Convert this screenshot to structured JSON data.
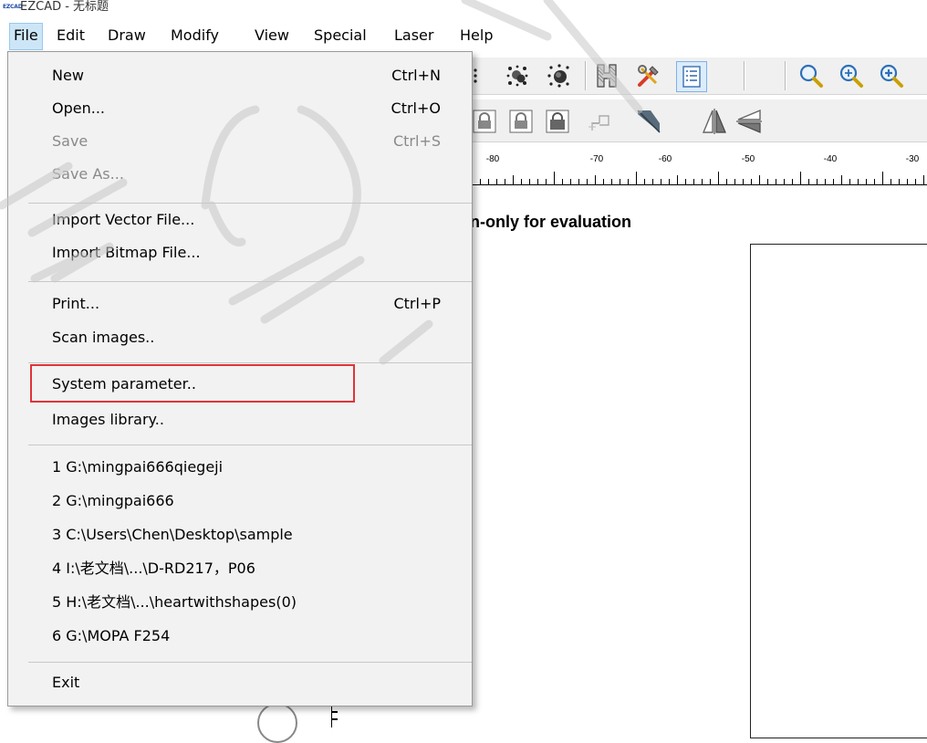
{
  "title_bar": {
    "logo": "EZCAD",
    "title": "EZCAD - 无标题"
  },
  "menubar": {
    "items": [
      {
        "label": "File",
        "active": true
      },
      {
        "label": "Edit"
      },
      {
        "label": "Draw"
      },
      {
        "label": "Modify"
      },
      {
        "label": "View"
      },
      {
        "label": "Special"
      },
      {
        "label": "Laser"
      },
      {
        "label": "Help"
      }
    ]
  },
  "file_menu": {
    "new": {
      "label": "New",
      "shortcut": "Ctrl+N"
    },
    "open": {
      "label": "Open...",
      "shortcut": "Ctrl+O"
    },
    "save": {
      "label": "Save",
      "shortcut": "Ctrl+S",
      "enabled": false
    },
    "save_as": {
      "label": "Save As...",
      "enabled": false
    },
    "import_vector": {
      "label": "Import Vector File..."
    },
    "import_bitmap": {
      "label": "Import Bitmap File..."
    },
    "print": {
      "label": "Print...",
      "shortcut": "Ctrl+P"
    },
    "scan": {
      "label": "Scan images.."
    },
    "system_parameter": {
      "label": "System parameter..",
      "highlighted": true
    },
    "images_library": {
      "label": "Images library.."
    },
    "recent": [
      "1 G:\\mingpai666qiegeji",
      "2 G:\\mingpai666",
      "3 C:\\Users\\Chen\\Desktop\\sample",
      "4 I:\\老文档\\...\\D-RD217，P06",
      "5 H:\\老文档\\...\\heartwithshapes(0)",
      "6 G:\\MOPA F254"
    ],
    "exit": {
      "label": "Exit"
    }
  },
  "ruler": {
    "labels": [
      "-80",
      "-70",
      "-60",
      "-50",
      "-40",
      "-30"
    ]
  },
  "canvas": {
    "evaluation_text": "n-only for evaluation"
  },
  "toolbar_icons": {
    "row1": [
      "select-points-icon",
      "node-edit-icon",
      "node-fill-icon",
      "hatch-icon",
      "tools-icon",
      "list-icon",
      "zoom-icon",
      "zoom-in-icon",
      "zoom-plus-icon"
    ],
    "row2": [
      "lock-icon",
      "unlock-icon",
      "lock-all-icon",
      "grid-snap-icon",
      "arrow-icon",
      "mirror-horizontal-icon",
      "mirror-vertical-icon"
    ]
  },
  "colors": {
    "highlight_box": "#e0333a",
    "menu_active": "#cde6f7",
    "menu_bg": "#f2f2f2"
  }
}
